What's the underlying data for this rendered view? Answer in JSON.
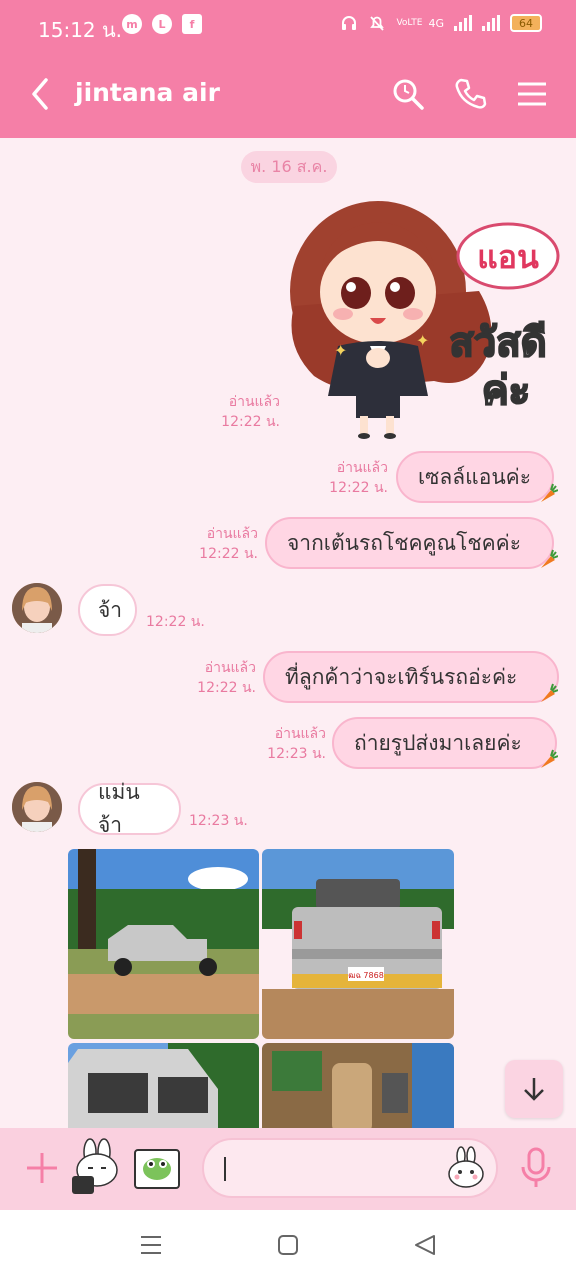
{
  "status_bar": {
    "time": "15:12 น.",
    "network": "4G",
    "volte": "VoLTE",
    "battery": "64"
  },
  "header": {
    "title": "jintana air"
  },
  "chat": {
    "date_chip": "พ. 16 ส.ค.",
    "sticker": {
      "read": "อ่านแล้ว",
      "time": "12:22 น.",
      "text_name": "แอน",
      "text_greeting1": "สวัสดี",
      "text_greeting2": "ค่ะ"
    },
    "messages": [
      {
        "dir": "out",
        "text": "เซลล์แอนค่ะ",
        "read": "อ่านแล้ว",
        "time": "12:22 น."
      },
      {
        "dir": "out",
        "text": "จากเต้นรถโชคคูณโชคค่ะ",
        "read": "อ่านแล้ว",
        "time": "12:22 น."
      },
      {
        "dir": "in",
        "text": "จ้า",
        "time": "12:22 น."
      },
      {
        "dir": "out",
        "text": "ที่ลูกค้าว่าจะเทิร์นรถอ่ะค่ะ",
        "read": "อ่านแล้ว",
        "time": "12:22 น."
      },
      {
        "dir": "out",
        "text": "ถ่ายรูปส่งมาเลยค่ะ",
        "read": "อ่านแล้ว",
        "time": "12:23 น."
      },
      {
        "dir": "in",
        "text": "แม่นจ้า",
        "time": "12:23 น."
      }
    ],
    "photos_plate": "ฒฉ 7868"
  },
  "colors": {
    "brand": "#f57fa7",
    "bubble_out": "#ffd6e4",
    "bubble_in": "#ffffff",
    "meta_text": "#e97aa0"
  },
  "icons": [
    "back-icon",
    "search-icon",
    "phone-icon",
    "menu-icon",
    "plus-icon",
    "sticker-icon",
    "photo-icon",
    "emoji-icon",
    "mic-icon",
    "arrow-down-icon"
  ]
}
